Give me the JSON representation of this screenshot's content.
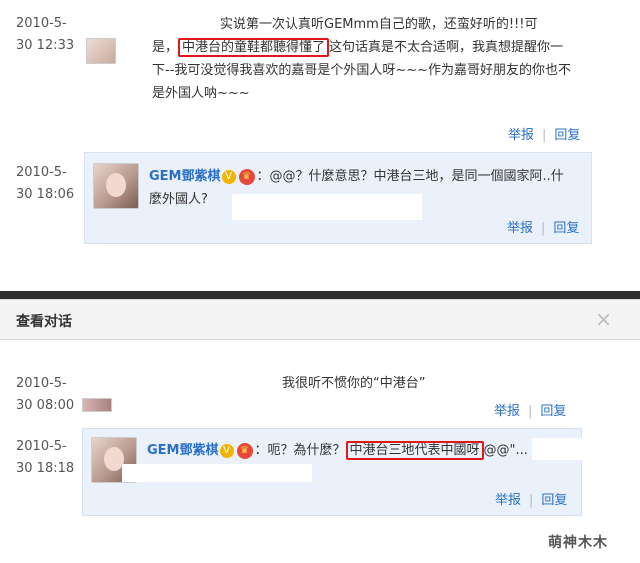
{
  "thread1": {
    "msg1": {
      "date": "2010-5-",
      "time": "30 12:33",
      "line1": "实说第一次认真听GEMmm自己的歌，还蛮好听的!!!可",
      "line2_pre": "是，",
      "line2_hl": "中港台的童鞋都聽得懂了",
      "line2_post": "这句话真是不太合适啊，我真想提醒你一",
      "line3": "下--我可没觉得我喜欢的嘉哥是个外国人呀~~~作为嘉哥好朋友的你也不",
      "line4": "是外国人呐~~~",
      "report": "举报",
      "reply": "回复"
    },
    "msg2": {
      "date": "2010-5-",
      "time": "30 18:06",
      "name": "GEM鄧紫棋",
      "badge_v": "V",
      "badge_crown": "♛",
      "line1": "：@@？什麼意思？中港台三地，是同一個國家阿..什",
      "line2": "麼外國人?",
      "report": "举报",
      "reply": "回复"
    }
  },
  "dialog": {
    "title": "查看对话",
    "close": "×",
    "msg1": {
      "date": "2010-5-",
      "time": "30 08:00",
      "text": "我很听不惯你的“中港台”",
      "report": "举报",
      "reply": "回复"
    },
    "msg2": {
      "date": "2010-5-",
      "time": "30 18:18",
      "name": "GEM鄧紫棋",
      "badge_v": "V",
      "badge_crown": "♛",
      "pre": "：呃？為什麼？",
      "hl": "中港台三地代表中國呀",
      "post": "@@\"...",
      "report": "举报",
      "reply": "回复"
    }
  },
  "watermark": "萌神木木"
}
